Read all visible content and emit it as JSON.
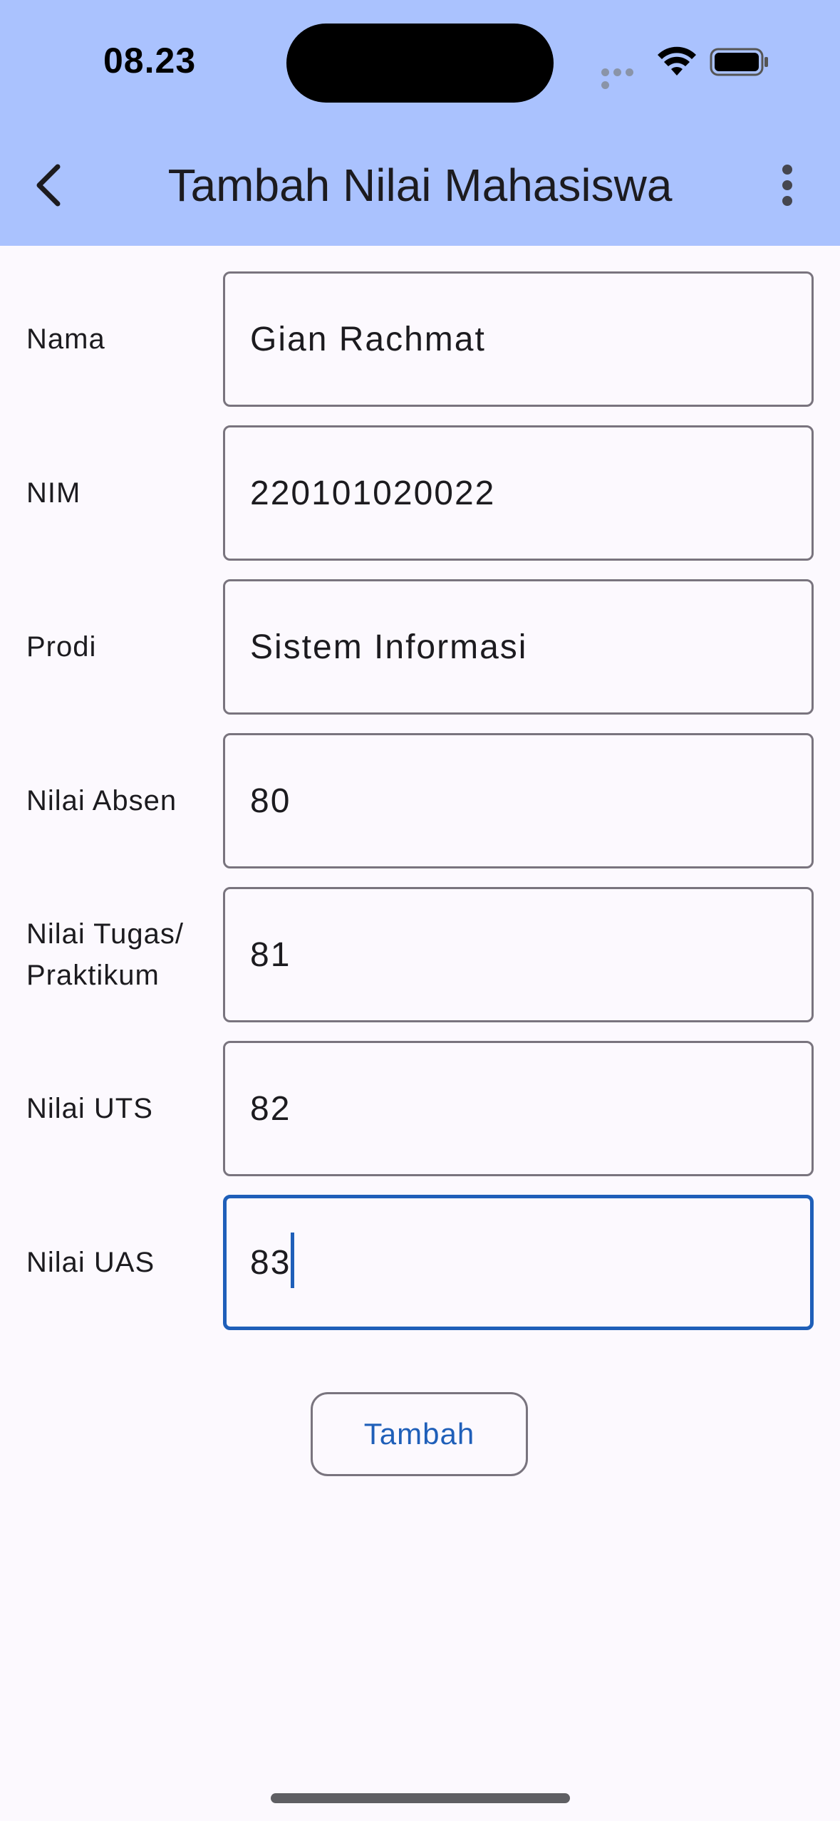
{
  "status_bar": {
    "time": "08.23",
    "icons": [
      "signal-dots-icon",
      "wifi-icon",
      "battery-icon"
    ]
  },
  "app_bar": {
    "title": "Tambah Nilai Mahasiswa",
    "back_icon": "chevron-left-icon",
    "menu_icon": "more-vertical-icon"
  },
  "form": {
    "fields": [
      {
        "label": "Nama",
        "value": "Gian Rachmat"
      },
      {
        "label": "NIM",
        "value": "220101020022"
      },
      {
        "label": "Prodi",
        "value": "Sistem Informasi"
      },
      {
        "label": "Nilai Absen",
        "value": "80"
      },
      {
        "label_line1": "Nilai Tugas/",
        "label_line2": "Praktikum",
        "value": "81"
      },
      {
        "label": "Nilai UTS",
        "value": "82"
      },
      {
        "label": "Nilai UAS",
        "value": "83",
        "focused": true
      }
    ],
    "submit_label": "Tambah"
  },
  "colors": {
    "app_bar_bg": "#aac2fe",
    "page_bg": "#fcf9fe",
    "accent": "#1f5fb9",
    "outline": "#79747e",
    "text": "#1c1b1f"
  }
}
